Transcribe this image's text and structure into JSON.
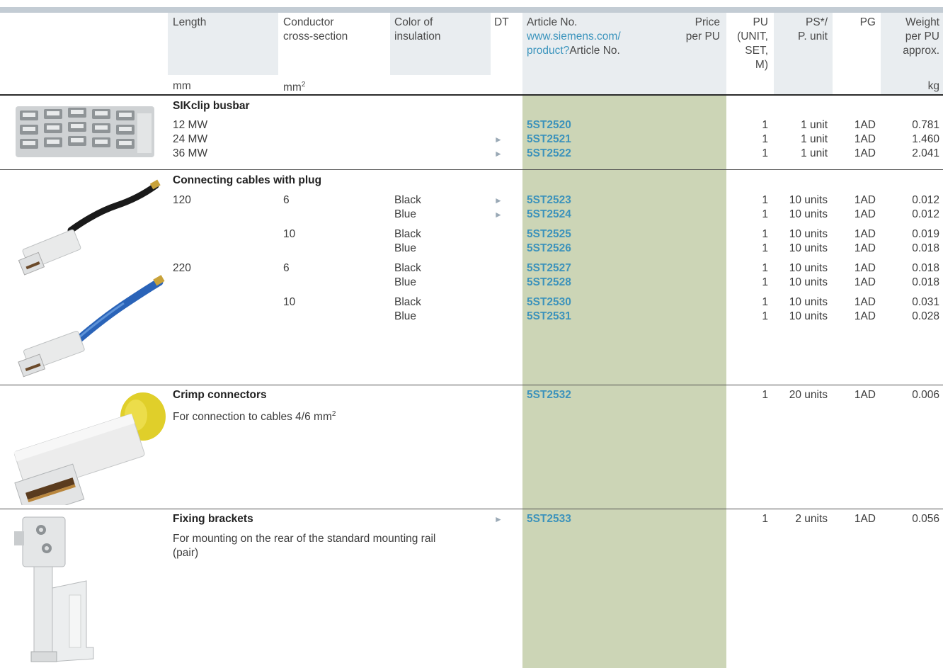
{
  "header": {
    "length": "Length",
    "conductor_l1": "Conductor",
    "conductor_l2": "cross-section",
    "color_l1": "Color of",
    "color_l2": "insulation",
    "dt": "DT",
    "article_l1": "Article No.",
    "article_link_l1": "www.siemens.com/",
    "article_link_l2": "product?",
    "article_suffix": "Article No.",
    "price_l1": "Price",
    "price_l2": "per PU",
    "pu_l1": "PU",
    "pu_l2": "(UNIT,",
    "pu_l3": "SET,",
    "pu_l4": "M)",
    "ps_l1": "PS*/",
    "ps_l2": "P. unit",
    "pg": "PG",
    "weight_l1": "Weight",
    "weight_l2": "per PU",
    "weight_l3": "approx.",
    "unit_mm": "mm",
    "unit_mm2": "mm",
    "unit_mm2_sup": "2",
    "unit_kg": "kg"
  },
  "sections": {
    "busbar": {
      "title": "SIKclip busbar",
      "rows": [
        {
          "length": "12 MW",
          "dt": "",
          "article": "5ST2520",
          "pu": "1",
          "ps": "1 unit",
          "pg": "1AD",
          "weight": "0.781"
        },
        {
          "length": "24 MW",
          "dt": "►",
          "article": "5ST2521",
          "pu": "1",
          "ps": "1 unit",
          "pg": "1AD",
          "weight": "1.460"
        },
        {
          "length": "36 MW",
          "dt": "►",
          "article": "5ST2522",
          "pu": "1",
          "ps": "1 unit",
          "pg": "1AD",
          "weight": "2.041"
        }
      ]
    },
    "cables": {
      "title": "Connecting cables with plug",
      "rows": [
        {
          "length": "120",
          "cs": "6",
          "color": "Black",
          "dt": "►",
          "article": "5ST2523",
          "pu": "1",
          "ps": "10 units",
          "pg": "1AD",
          "weight": "0.012"
        },
        {
          "length": "",
          "cs": "",
          "color": "Blue",
          "dt": "►",
          "article": "5ST2524",
          "pu": "1",
          "ps": "10 units",
          "pg": "1AD",
          "weight": "0.012"
        },
        {
          "length": "",
          "cs": "10",
          "color": "Black",
          "dt": "",
          "article": "5ST2525",
          "pu": "1",
          "ps": "10 units",
          "pg": "1AD",
          "weight": "0.019"
        },
        {
          "length": "",
          "cs": "",
          "color": "Blue",
          "dt": "",
          "article": "5ST2526",
          "pu": "1",
          "ps": "10 units",
          "pg": "1AD",
          "weight": "0.018"
        },
        {
          "length": "220",
          "cs": "6",
          "color": "Black",
          "dt": "",
          "article": "5ST2527",
          "pu": "1",
          "ps": "10 units",
          "pg": "1AD",
          "weight": "0.018"
        },
        {
          "length": "",
          "cs": "",
          "color": "Blue",
          "dt": "",
          "article": "5ST2528",
          "pu": "1",
          "ps": "10 units",
          "pg": "1AD",
          "weight": "0.018"
        },
        {
          "length": "",
          "cs": "10",
          "color": "Black",
          "dt": "",
          "article": "5ST2530",
          "pu": "1",
          "ps": "10 units",
          "pg": "1AD",
          "weight": "0.031"
        },
        {
          "length": "",
          "cs": "",
          "color": "Blue",
          "dt": "",
          "article": "5ST2531",
          "pu": "1",
          "ps": "10 units",
          "pg": "1AD",
          "weight": "0.028"
        }
      ]
    },
    "crimp": {
      "title": "Crimp connectors",
      "desc": "For connection to cables 4/6 mm",
      "desc_sup": "2",
      "article": "5ST2532",
      "pu": "1",
      "ps": "20 units",
      "pg": "1AD",
      "weight": "0.006"
    },
    "brackets": {
      "title": "Fixing brackets",
      "desc_l1": "For mounting on the rear of the standard mounting rail",
      "desc_l2": "(pair)",
      "dt": "►",
      "article": "5ST2533",
      "pu": "1",
      "ps": "2 units",
      "pg": "1AD",
      "weight": "0.056"
    }
  },
  "colors": {
    "green_column": "#ccd5b6",
    "header_shade": "#e9edf0",
    "article_blue": "#3d93bb",
    "dt_arrow": "#9aa9b6"
  }
}
